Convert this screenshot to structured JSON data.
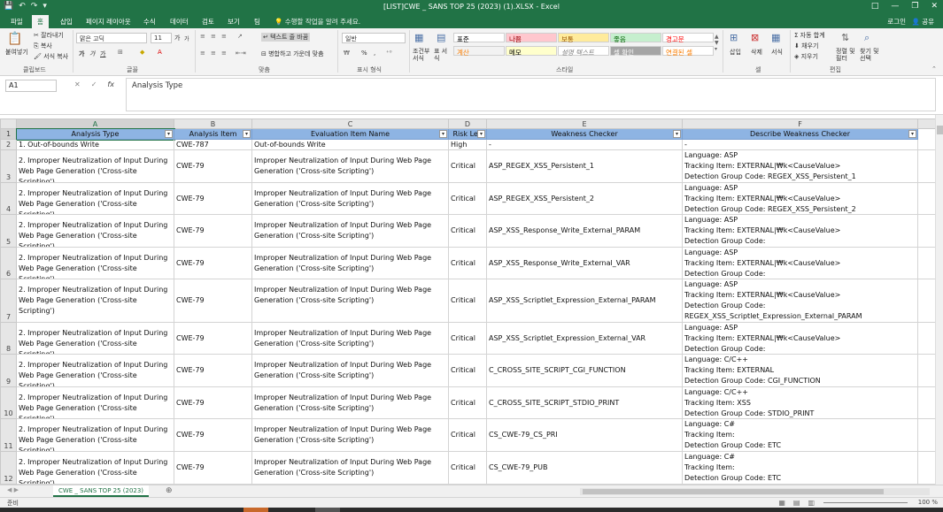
{
  "window": {
    "title": "[LIST]CWE _ SANS TOP 25 (2023) (1).XLSX - Excel",
    "controls": [
      "□",
      "—",
      "❐",
      "✕"
    ]
  },
  "quick_access": [
    "💾",
    "↶",
    "↷",
    "▾"
  ],
  "tabs": [
    "파일",
    "홈",
    "삽입",
    "페이지 레이아웃",
    "수식",
    "데이터",
    "검토",
    "보기",
    "팀"
  ],
  "active_tab": "홈",
  "tell_me": "수행할 작업을 알려 주세요.",
  "login": "로그인",
  "share": "공유",
  "ribbon": {
    "clipboard": {
      "paste": "붙여넣기",
      "cut": "잘라내기",
      "copy": "복사",
      "format_painter": "서식 복사",
      "label": "클립보드"
    },
    "font": {
      "name": "맑은 고딕",
      "size": "11",
      "grow": "가",
      "shrink": "가",
      "bold": "가",
      "italic": "가",
      "underline": "가",
      "label": "글꼴"
    },
    "alignment": {
      "wrap_text": "텍스트 줄 바꿈",
      "merge": "병합하고 가운데 맞춤",
      "label": "맞춤"
    },
    "number": {
      "format": "일반",
      "percent": "%",
      "comma": ",",
      "label": "표시 형식"
    },
    "styles": {
      "conditional": "조건부 서식",
      "table": "표 서식",
      "cells": [
        {
          "text": "표준",
          "bg": "#ffffff",
          "fg": "#000000"
        },
        {
          "text": "나쁨",
          "bg": "#ffc7ce",
          "fg": "#9c0006"
        },
        {
          "text": "보통",
          "bg": "#ffeb9c",
          "fg": "#9c5700"
        },
        {
          "text": "좋음",
          "bg": "#c6efce",
          "fg": "#006100"
        },
        {
          "text": "경고문",
          "bg": "#ffffff",
          "fg": "#ff0000"
        },
        {
          "text": "계산",
          "bg": "#f2f2f2",
          "fg": "#fa7d00"
        },
        {
          "text": "메모",
          "bg": "#ffffcc",
          "fg": "#000000"
        },
        {
          "text": "설명 텍스트",
          "bg": "#ffffff",
          "fg": "#7f7f7f"
        },
        {
          "text": "셀 확인",
          "bg": "#a5a5a5",
          "fg": "#ffffff"
        },
        {
          "text": "연결된 셀",
          "bg": "#ffffff",
          "fg": "#fa7d00"
        }
      ],
      "label": "스타일"
    },
    "cells_group": {
      "insert": "삽입",
      "delete": "삭제",
      "format": "서식",
      "label": "셀"
    },
    "editing": {
      "autosum": "자동 합계",
      "fill": "채우기",
      "clear": "지우기",
      "sort": "정렬 및 필터",
      "find": "찾기 및 선택",
      "label": "편집"
    }
  },
  "formula_bar": {
    "name_box": "A1",
    "cancel": "✕",
    "enter": "✓",
    "fx": "fx",
    "content": "Analysis Type"
  },
  "columns": [
    "A",
    "B",
    "C",
    "D",
    "E",
    "F"
  ],
  "headers": [
    "Analysis Type",
    "Analysis Item",
    "Evaluation Item Name",
    "Risk Lev",
    "Weakness Checker",
    "Describe Weakness Checker"
  ],
  "rows": [
    {
      "num": "2",
      "a": "1. Out-of-bounds Write",
      "b": "CWE-787",
      "c": "Out-of-bounds Write",
      "d": "High",
      "e": "-",
      "f": "-"
    },
    {
      "num": "3",
      "a": "2. Improper Neutralization of Input During Web Page Generation ('Cross-site Scripting')",
      "b": "CWE-79",
      "c": "Improper Neutralization of Input During Web Page Generation ('Cross-site Scripting')",
      "d": "Critical",
      "e": "ASP_REGEX_XSS_Persistent_1",
      "f": "Language: ASP\nTracking Item: EXTERNAL|₩k<CauseValue>\nDetection Group Code: REGEX_XSS_Persistent_1"
    },
    {
      "num": "4",
      "a": "2. Improper Neutralization of Input During Web Page Generation ('Cross-site Scripting')",
      "b": "CWE-79",
      "c": "Improper Neutralization of Input During Web Page Generation ('Cross-site Scripting')",
      "d": "Critical",
      "e": "ASP_REGEX_XSS_Persistent_2",
      "f": "Language: ASP\nTracking Item: EXTERNAL|₩k<CauseValue>\nDetection Group Code: REGEX_XSS_Persistent_2"
    },
    {
      "num": "5",
      "a": "2. Improper Neutralization of Input During Web Page Generation ('Cross-site Scripting')",
      "b": "CWE-79",
      "c": "Improper Neutralization of Input During Web Page Generation ('Cross-site Scripting')",
      "d": "Critical",
      "e": "ASP_XSS_Response_Write_External_PARAM",
      "f": "Language: ASP\nTracking Item: EXTERNAL|₩k<CauseValue>\nDetection Group Code: REGEX_XSS_Response_Write_External_PARAM"
    },
    {
      "num": "6",
      "a": "2. Improper Neutralization of Input During Web Page Generation ('Cross-site Scripting')",
      "b": "CWE-79",
      "c": "Improper Neutralization of Input During Web Page Generation ('Cross-site Scripting')",
      "d": "Critical",
      "e": "ASP_XSS_Response_Write_External_VAR",
      "f": "Language: ASP\nTracking Item: EXTERNAL|₩k<CauseValue>\nDetection Group Code: REGEX_XSS_Response_Write_External_VAR"
    },
    {
      "num": "7",
      "a": "2. Improper Neutralization of Input During Web Page Generation ('Cross-site Scripting')",
      "b": "CWE-79",
      "c": "Improper Neutralization of Input During Web Page Generation ('Cross-site Scripting')",
      "d": "Critical",
      "e": "ASP_XSS_Scriptlet_Expression_External_PARAM",
      "f": "Language: ASP\nTracking Item: EXTERNAL|₩k<CauseValue>\nDetection Group Code:\nREGEX_XSS_Scriptlet_Expression_External_PARAM"
    },
    {
      "num": "8",
      "a": "2. Improper Neutralization of Input During Web Page Generation ('Cross-site Scripting')",
      "b": "CWE-79",
      "c": "Improper Neutralization of Input During Web Page Generation ('Cross-site Scripting')",
      "d": "Critical",
      "e": "ASP_XSS_Scriptlet_Expression_External_VAR",
      "f": "Language: ASP\nTracking Item: EXTERNAL|₩k<CauseValue>\nDetection Group Code: REGEX_XSS_Scriptlet_Expression_External_VAR"
    },
    {
      "num": "9",
      "a": "2. Improper Neutralization of Input During Web Page Generation ('Cross-site Scripting')",
      "b": "CWE-79",
      "c": "Improper Neutralization of Input During Web Page Generation ('Cross-site Scripting')",
      "d": "Critical",
      "e": "C_CROSS_SITE_SCRIPT_CGI_FUNCTION",
      "f": "Language: C/C++\nTracking Item: EXTERNAL\nDetection Group Code: CGI_FUNCTION"
    },
    {
      "num": "10",
      "a": "2. Improper Neutralization of Input During Web Page Generation ('Cross-site Scripting')",
      "b": "CWE-79",
      "c": "Improper Neutralization of Input During Web Page Generation ('Cross-site Scripting')",
      "d": "Critical",
      "e": "C_CROSS_SITE_SCRIPT_STDIO_PRINT",
      "f": "Language: C/C++\nTracking Item: XSS\nDetection Group Code: STDIO_PRINT"
    },
    {
      "num": "11",
      "a": "2. Improper Neutralization of Input During Web Page Generation ('Cross-site Scripting')",
      "b": "CWE-79",
      "c": "Improper Neutralization of Input During Web Page Generation ('Cross-site Scripting')",
      "d": "Critical",
      "e": "CS_CWE-79_CS_PRI",
      "f": "Language: C#\nTracking Item:\nDetection Group Code: ETC"
    },
    {
      "num": "12",
      "a": "2. Improper Neutralization of Input During Web Page Generation ('Cross-site Scripting')",
      "b": "CWE-79",
      "c": "Improper Neutralization of Input During Web Page Generation ('Cross-site Scripting')",
      "d": "Critical",
      "e": "CS_CWE-79_PUB",
      "f": "Language: C#\nTracking Item:\nDetection Group Code: ETC"
    }
  ],
  "sheet_tab": "CWE _ SANS TOP 25 (2023)",
  "add_sheet": "⊕",
  "status": {
    "ready": "준비",
    "zoom": "100 %"
  },
  "colors": {
    "accent": "#217346",
    "header_fill": "#8eb4e3"
  }
}
